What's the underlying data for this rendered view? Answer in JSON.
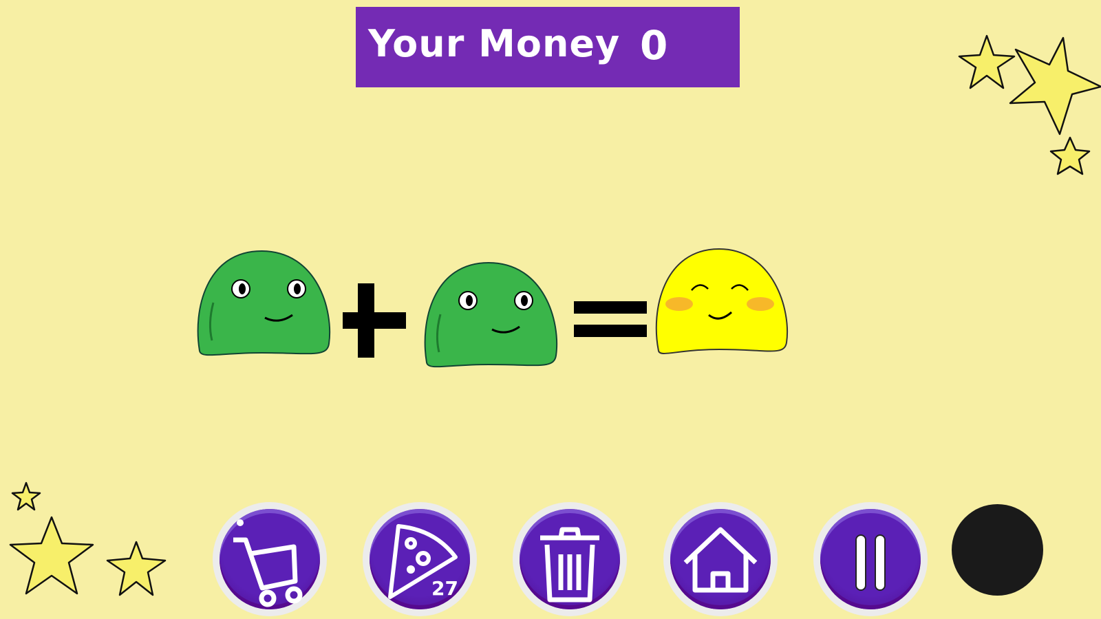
{
  "hud": {
    "money_label": "Your Money",
    "money_value": "0"
  },
  "equation": {
    "left": "green-slime",
    "operator1": "plus",
    "right": "green-slime",
    "operator2": "equals",
    "result": "yellow-slime"
  },
  "toolbar": {
    "buttons": [
      {
        "name": "shop",
        "icon": "shopping-cart-icon"
      },
      {
        "name": "food",
        "icon": "pizza-icon",
        "count": "27"
      },
      {
        "name": "trash",
        "icon": "trash-icon"
      },
      {
        "name": "home",
        "icon": "home-icon"
      },
      {
        "name": "pause",
        "icon": "pause-icon"
      }
    ]
  },
  "colors": {
    "background": "#f7efa4",
    "panel": "#742bb4",
    "button": "#5b20b6",
    "green_slime": "#3ab54a",
    "yellow_slime": "#ffff00",
    "star": "#f7ef6a"
  }
}
